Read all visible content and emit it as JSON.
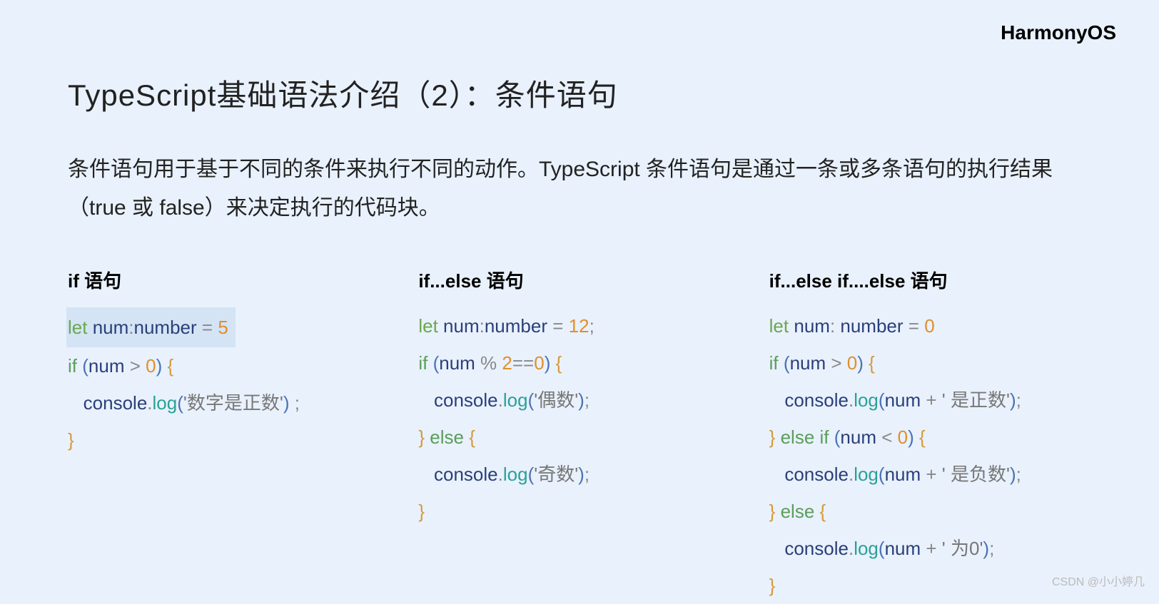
{
  "brand": "HarmonyOS",
  "title": "TypeScript基础语法介绍（2）：条件语句",
  "description": "条件语句用于基于不同的条件来执行不同的动作。TypeScript 条件语句是通过一条或多条语句的执行结果（true 或 false）来决定执行的代码块。",
  "columns": [
    {
      "title": "if 语句",
      "code": {
        "declare": {
          "let": "let",
          "name": "num",
          "type": "number",
          "eq": "=",
          "val": "5"
        },
        "if_open": {
          "if": "if",
          "lp": "(",
          "cond_l": "num",
          "op": ">",
          "cond_r": "0",
          "rp": ")",
          "lb": "{"
        },
        "log": {
          "obj": "console",
          "dot": ".",
          "method": "log",
          "lp": "(",
          "str": "'数字是正数'",
          "rp": ")",
          "semi": " ;"
        },
        "close": "}"
      }
    },
    {
      "title": "if...else 语句",
      "code": {
        "declare": {
          "let": "let",
          "name": "num",
          "type": "number",
          "eq": "=",
          "val": "12",
          "semi": ";"
        },
        "if_open": {
          "if": "if",
          "lp": "(",
          "cond_l": "num",
          "op": "%",
          "mid": "2",
          "eqop": "==",
          "cond_r": "0",
          "rp": ")",
          "lb": "{"
        },
        "log1": {
          "obj": "console",
          "dot": ".",
          "method": "log",
          "lp": "(",
          "str": "'偶数'",
          "rp": ")",
          "semi": ";"
        },
        "else_open": {
          "rb": "}",
          "else": "else",
          "lb": "{"
        },
        "log2": {
          "obj": "console",
          "dot": ".",
          "method": "log",
          "lp": "(",
          "str": "'奇数'",
          "rp": ")",
          "semi": ";"
        },
        "close": "}"
      }
    },
    {
      "title": "if...else if....else 语句",
      "code": {
        "declare": {
          "let": "let",
          "name": "num",
          "type": "number",
          "eq": "=",
          "val": "0"
        },
        "if_open": {
          "if": "if",
          "lp": "(",
          "cond_l": "num",
          "op": ">",
          "cond_r": "0",
          "rp": ")",
          "lb": "{"
        },
        "log1": {
          "obj": "console",
          "dot": ".",
          "method": "log",
          "lp": "(",
          "arg": "num",
          "plus": "+",
          "str": "' 是正数'",
          "rp": ")",
          "semi": ";"
        },
        "elseif_open": {
          "rb": "}",
          "else": "else if",
          "lp": "(",
          "cond_l": "num",
          "op": "<",
          "cond_r": "0",
          "rp": ")",
          "lb": "{"
        },
        "log2": {
          "obj": "console",
          "dot": ".",
          "method": "log",
          "lp": "(",
          "arg": "num",
          "plus": "+",
          "str": "' 是负数'",
          "rp": ")",
          "semi": ";"
        },
        "else_open": {
          "rb": "}",
          "else": "else",
          "lb": "{"
        },
        "log3": {
          "obj": "console",
          "dot": ".",
          "method": "log",
          "lp": "(",
          "arg": "num",
          "plus": "+",
          "str": "' 为0'",
          "rp": ")",
          "semi": ";"
        },
        "close": "}"
      }
    }
  ],
  "watermark": "CSDN @小小婷几"
}
